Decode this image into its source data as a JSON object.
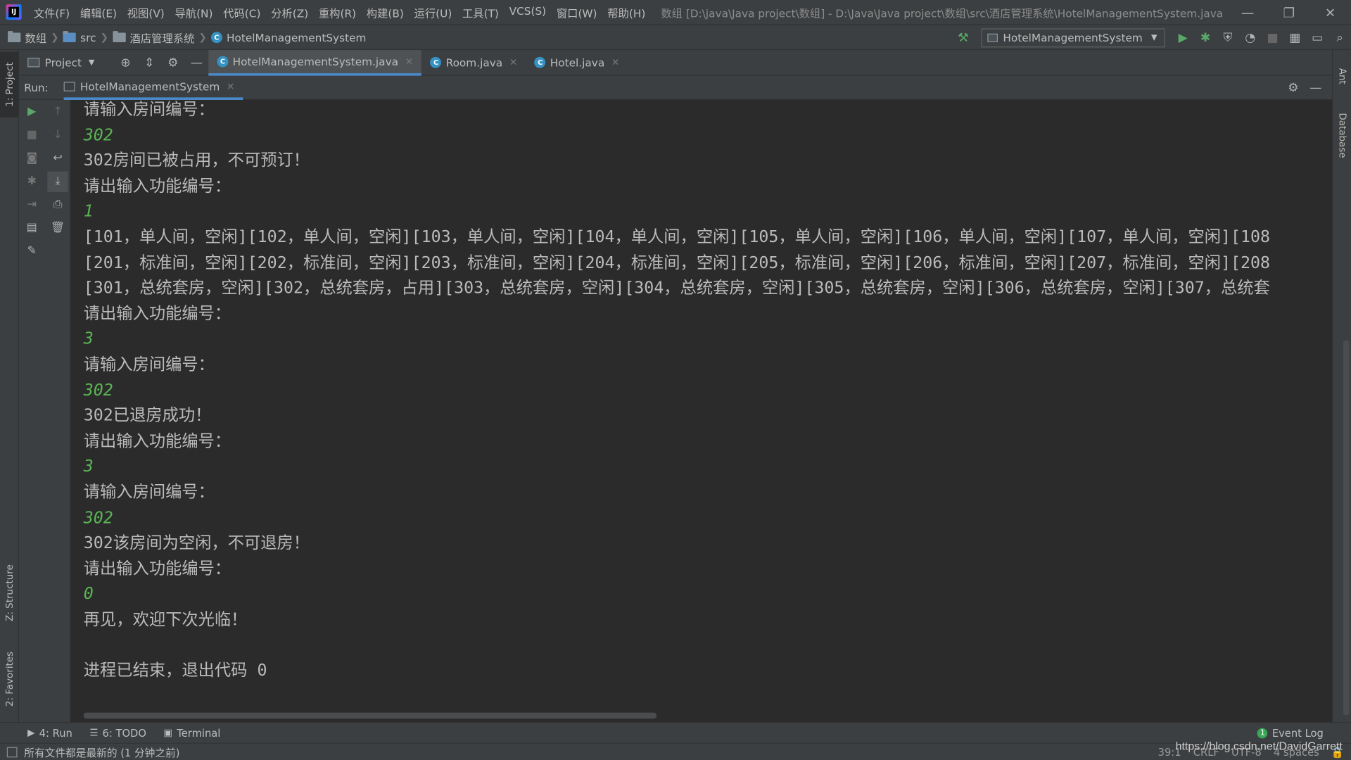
{
  "titlebar": {
    "menus": [
      "文件(F)",
      "编辑(E)",
      "视图(V)",
      "导航(N)",
      "代码(C)",
      "分析(Z)",
      "重构(R)",
      "构建(B)",
      "运行(U)",
      "工具(T)",
      "VCS(S)",
      "窗口(W)",
      "帮助(H)"
    ],
    "window_title": "数组 [D:\\java\\Java project\\数组] - D:\\Java\\Java project\\数组\\src\\酒店管理系统\\HotelManagementSystem.java",
    "controls": [
      "—",
      "❐",
      "✕"
    ]
  },
  "breadcrumb": {
    "items": [
      "数组",
      "src",
      "酒店管理系统",
      "HotelManagementSystem"
    ]
  },
  "run_config": {
    "selected": "HotelManagementSystem"
  },
  "project_panel": {
    "label": "Project"
  },
  "editor_tabs": [
    {
      "label": "HotelManagementSystem.java",
      "active": true
    },
    {
      "label": "Room.java",
      "active": false
    },
    {
      "label": "Hotel.java",
      "active": false
    }
  ],
  "run_panel": {
    "label": "Run:",
    "tab": "HotelManagementSystem"
  },
  "console": {
    "lines": [
      {
        "text": "请输入房间编号：",
        "type": "out"
      },
      {
        "text": "302",
        "type": "in"
      },
      {
        "text": "302房间已被占用，不可预订！",
        "type": "out"
      },
      {
        "text": "请出输入功能编号：",
        "type": "out"
      },
      {
        "text": "1",
        "type": "in"
      },
      {
        "text": "[101，单人间，空闲][102，单人间，空闲][103，单人间，空闲][104，单人间，空闲][105，单人间，空闲][106，单人间，空闲][107，单人间，空闲][108",
        "type": "out"
      },
      {
        "text": "[201，标准间，空闲][202，标准间，空闲][203，标准间，空闲][204，标准间，空闲][205，标准间，空闲][206，标准间，空闲][207，标准间，空闲][208",
        "type": "out"
      },
      {
        "text": "[301，总统套房，空闲][302，总统套房，占用][303，总统套房，空闲][304，总统套房，空闲][305，总统套房，空闲][306，总统套房，空闲][307，总统套",
        "type": "out"
      },
      {
        "text": "请出输入功能编号：",
        "type": "out"
      },
      {
        "text": "3",
        "type": "in"
      },
      {
        "text": "请输入房间编号：",
        "type": "out"
      },
      {
        "text": "302",
        "type": "in"
      },
      {
        "text": "302已退房成功！",
        "type": "out"
      },
      {
        "text": "请出输入功能编号：",
        "type": "out"
      },
      {
        "text": "3",
        "type": "in"
      },
      {
        "text": "请输入房间编号：",
        "type": "out"
      },
      {
        "text": "302",
        "type": "in"
      },
      {
        "text": "302该房间为空闲，不可退房！",
        "type": "out"
      },
      {
        "text": "请出输入功能编号：",
        "type": "out"
      },
      {
        "text": "0",
        "type": "in"
      },
      {
        "text": "再见，欢迎下次光临！",
        "type": "out"
      },
      {
        "text": "",
        "type": "out"
      },
      {
        "text": "进程已结束，退出代码 0",
        "type": "out"
      }
    ]
  },
  "tool_windows": {
    "left_top": "1: Project",
    "left_structure": "Z: Structure",
    "left_favorites": "2: Favorites",
    "right_ant": "Ant",
    "right_database": "Database"
  },
  "bottom_tabs": [
    {
      "label": "4: Run",
      "icon": "▶"
    },
    {
      "label": "6: TODO",
      "icon": "☰"
    },
    {
      "label": "Terminal",
      "icon": "▣"
    }
  ],
  "event_log": {
    "label": "Event Log",
    "count": "1"
  },
  "status": {
    "message": "所有文件都是最新的 (1 分钟之前)",
    "position": "39:1",
    "line_sep": "CRLF",
    "encoding": "UTF-8",
    "indent": "4 spaces"
  },
  "watermark": "https://blog.csdn.net/DavidGarrett",
  "colors": {
    "accent": "#4a88c7",
    "input": "#5ab553",
    "bg": "#2b2b2b",
    "panel": "#3c3f41"
  }
}
